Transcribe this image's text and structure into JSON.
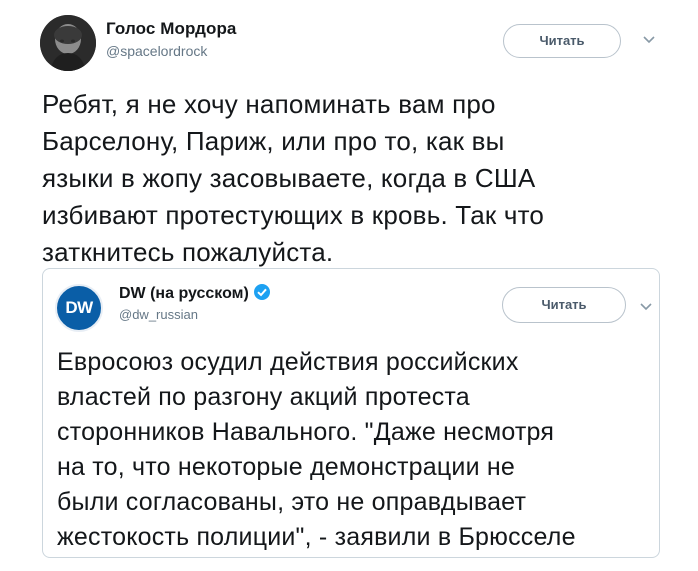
{
  "tweet": {
    "author": {
      "display_name": "Голос Мордора",
      "handle": "@spacelordrock"
    },
    "follow_label": "Читать",
    "text": "Ребят, я не хочу напоминать вам про\nБарселону, Париж, или про то, как вы\nязыки в жопу засовываете, когда в США\nизбивают протестующих в кровь. Так что\nзаткнитесь пожалуйста."
  },
  "quoted_tweet": {
    "author": {
      "display_name": "DW (на русском)",
      "handle": "@dw_russian",
      "logo_text": "DW",
      "verified": true
    },
    "follow_label": "Читать",
    "text": "Евросоюз осудил действия российских\nвластей по разгону акций протеста\nсторонников Навального. \"Даже несмотря\nна то, что некоторые демонстрации не\nбыли согласованы, это не оправдывает\nжестокость полиции\", - заявили в Брюсселе"
  },
  "colors": {
    "text_primary": "#14171a",
    "text_secondary": "#657786",
    "border": "#ccd6dd",
    "verified_blue": "#1da1f2",
    "dw_blue": "#0a5ea7"
  },
  "icons": {
    "verified": "verified-badge-icon",
    "more": "chevron-down-icon"
  }
}
